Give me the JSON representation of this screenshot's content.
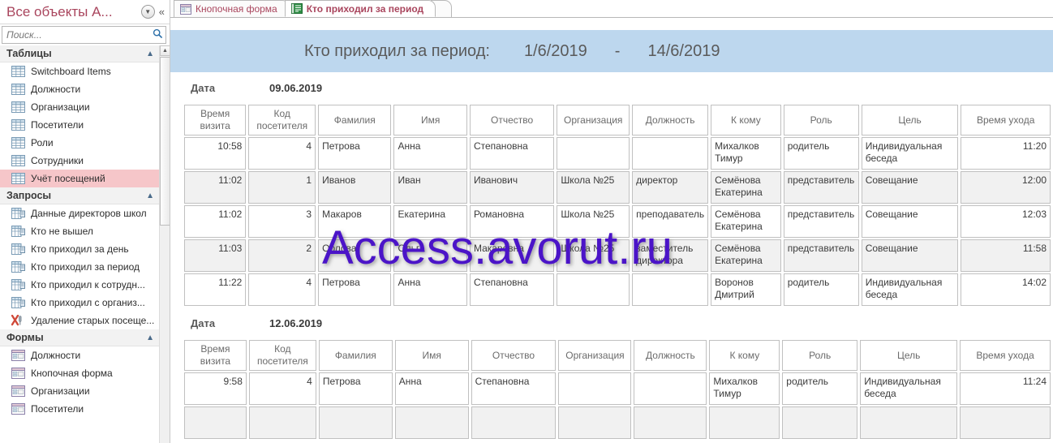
{
  "navpane": {
    "title": "Все объекты A...",
    "dropdown_icon": "chevron-down-circle-icon",
    "collapse_icon": "double-chevron-left-icon",
    "search_placeholder": "Поиск...",
    "search_value": "",
    "search_icon": "search-icon",
    "groups": [
      {
        "label": "Таблицы",
        "collapse_icon": "chevron-up-icon",
        "items": [
          {
            "label": "Switchboard Items",
            "icon": "table-icon",
            "selected": false
          },
          {
            "label": "Должности",
            "icon": "table-icon",
            "selected": false
          },
          {
            "label": "Организации",
            "icon": "table-icon",
            "selected": false
          },
          {
            "label": "Посетители",
            "icon": "table-icon",
            "selected": false
          },
          {
            "label": "Роли",
            "icon": "table-icon",
            "selected": false
          },
          {
            "label": "Сотрудники",
            "icon": "table-icon",
            "selected": false
          },
          {
            "label": "Учёт посещений",
            "icon": "table-icon",
            "selected": true
          }
        ]
      },
      {
        "label": "Запросы",
        "collapse_icon": "chevron-up-icon",
        "items": [
          {
            "label": "Данные директоров школ",
            "icon": "query-icon",
            "selected": false
          },
          {
            "label": "Кто не вышел",
            "icon": "query-icon",
            "selected": false
          },
          {
            "label": "Кто приходил за день",
            "icon": "query-icon",
            "selected": false
          },
          {
            "label": "Кто приходил за период",
            "icon": "query-icon",
            "selected": false
          },
          {
            "label": "Кто приходил к сотрудн...",
            "icon": "query-icon",
            "selected": false
          },
          {
            "label": "Кто приходил с организ...",
            "icon": "query-icon",
            "selected": false
          },
          {
            "label": "Удаление старых посеще...",
            "icon": "delete-query-icon",
            "selected": false
          }
        ]
      },
      {
        "label": "Формы",
        "collapse_icon": "chevron-up-icon",
        "items": [
          {
            "label": "Должности",
            "icon": "form-icon",
            "selected": false
          },
          {
            "label": "Кнопочная форма",
            "icon": "form-icon",
            "selected": false
          },
          {
            "label": "Организации",
            "icon": "form-icon",
            "selected": false
          },
          {
            "label": "Посетители",
            "icon": "form-icon",
            "selected": false
          }
        ]
      }
    ]
  },
  "tabs": [
    {
      "label": "Кнопочная форма",
      "icon": "form-icon",
      "active": false
    },
    {
      "label": "Кто приходил за период",
      "icon": "report-icon",
      "active": true
    }
  ],
  "report": {
    "header": {
      "title": "Кто приходил за период:",
      "date_from": "1/6/2019",
      "dash": "-",
      "date_to": "14/6/2019",
      "background_color": "#bdd7ee"
    },
    "date_label": "Дата",
    "columns": [
      "Время визита",
      "Код посетителя",
      "Фамилия",
      "Имя",
      "Отчество",
      "Организация",
      "Должность",
      "К кому",
      "Роль",
      "Цель",
      "Время ухода"
    ],
    "groups": [
      {
        "date": "09.06.2019",
        "rows": [
          {
            "time_in": "10:58",
            "code": "4",
            "surname": "Петрова",
            "name": "Анна",
            "patronymic": "Степановна",
            "organization": "",
            "position": "",
            "to_whom": "Михалков Тимур",
            "role": "родитель",
            "goal": "Индивидуальная беседа",
            "time_out": "11:20"
          },
          {
            "time_in": "11:02",
            "code": "1",
            "surname": "Иванов",
            "name": "Иван",
            "patronymic": "Иванович",
            "organization": "Школа №25",
            "position": "директор",
            "to_whom": "Семёнова Екатерина",
            "role": "представитель",
            "goal": "Совещание",
            "time_out": "12:00"
          },
          {
            "time_in": "11:02",
            "code": "3",
            "surname": "Макаров",
            "name": "Екатерина",
            "patronymic": "Романовна",
            "organization": "Школа №25",
            "position": "преподаватель",
            "to_whom": "Семёнова Екатерина",
            "role": "представитель",
            "goal": "Совещание",
            "time_out": "12:03"
          },
          {
            "time_in": "11:03",
            "code": "2",
            "surname": "Орлова",
            "name": "Ольга",
            "patronymic": "Макаровна",
            "organization": "Школа №25",
            "position": "заместитель директора",
            "to_whom": "Семёнова Екатерина",
            "role": "представитель",
            "goal": "Совещание",
            "time_out": "11:58"
          },
          {
            "time_in": "11:22",
            "code": "4",
            "surname": "Петрова",
            "name": "Анна",
            "patronymic": "Степановна",
            "organization": "",
            "position": "",
            "to_whom": "Воронов Дмитрий",
            "role": "родитель",
            "goal": "Индивидуальная беседа",
            "time_out": "14:02"
          }
        ]
      },
      {
        "date": "12.06.2019",
        "rows": [
          {
            "time_in": "9:58",
            "code": "4",
            "surname": "Петрова",
            "name": "Анна",
            "patronymic": "Степановна",
            "organization": "",
            "position": "",
            "to_whom": "Михалков Тимур",
            "role": "родитель",
            "goal": "Индивидуальная беседа",
            "time_out": "11:24"
          },
          {
            "time_in": "",
            "code": "",
            "surname": "",
            "name": "",
            "patronymic": "",
            "organization": "",
            "position": "",
            "to_whom": "",
            "role": "",
            "goal": "",
            "time_out": ""
          }
        ]
      }
    ]
  },
  "watermark": {
    "text": "Access.avorut.ru",
    "color": "#4b14c8"
  }
}
